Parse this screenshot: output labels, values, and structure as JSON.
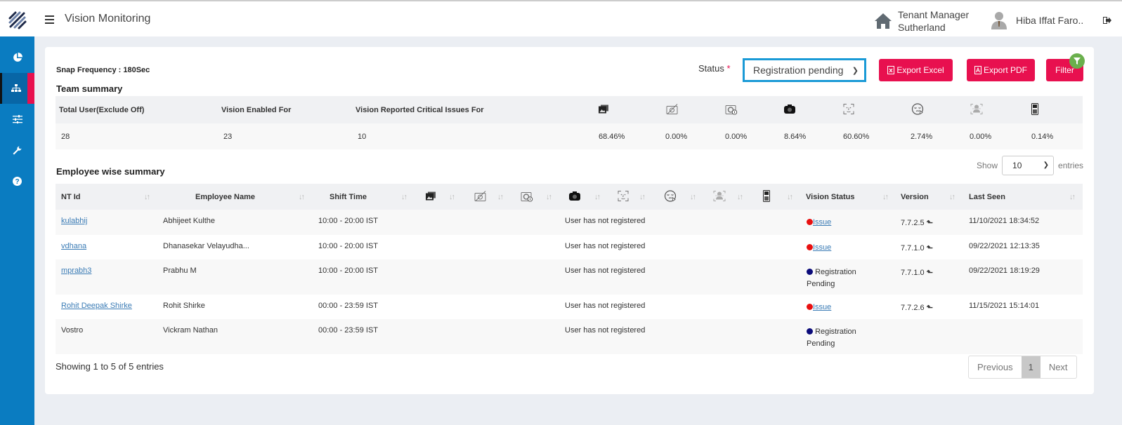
{
  "header": {
    "title": "Vision Monitoring",
    "tenant_role": "Tenant Manager",
    "tenant_name": "Sutherland",
    "user_name": "Hiba Iffat Faro.."
  },
  "sidebar": {
    "items": [
      {
        "name": "dashboard",
        "icon": "pie-chart-icon"
      },
      {
        "name": "hierarchy",
        "icon": "sitemap-icon",
        "active": true
      },
      {
        "name": "settings",
        "icon": "sliders-icon"
      },
      {
        "name": "tools",
        "icon": "wrench-icon"
      },
      {
        "name": "help",
        "icon": "question-icon"
      }
    ]
  },
  "toolbar": {
    "snap_frequency": "Snap Frequency : 180Sec",
    "status_label": "Status",
    "status_required": "*",
    "status_value": "Registration pending",
    "export_excel": "Export Excel",
    "export_pdf": "Export PDF",
    "filter": "Filter"
  },
  "team_summary": {
    "title": "Team summary",
    "headers": [
      "Total User(Exclude Off)",
      "Vision Enabled For",
      "Vision Reported Critical Issues For"
    ],
    "icon_headers": [
      "multiple-images-icon",
      "camera-off-icon",
      "camera-info-icon",
      "camera-icon",
      "face-scan-icon",
      "sleepy-face-icon",
      "person-scan-icon",
      "mobile-phone-icon"
    ],
    "values": [
      "28",
      "23",
      "10"
    ],
    "icon_values": [
      "68.46%",
      "0.00%",
      "0.00%",
      "8.64%",
      "60.60%",
      "2.74%",
      "0.00%",
      "0.14%"
    ]
  },
  "employee_summary": {
    "title": "Employee wise summary",
    "show_label": "Show",
    "entries_value": "10",
    "entries_label": "entries",
    "columns": [
      "NT Id",
      "Employee Name",
      "Shift Time",
      "Vision Status",
      "Version",
      "Last Seen"
    ],
    "rows": [
      {
        "nt_id": "kulabhij",
        "nt_link": true,
        "name": "Abhijeet Kulthe",
        "shift": "10:00 - 20:00 IST",
        "note": "User has not registered",
        "status": "Issue",
        "status_color": "#e81010",
        "status_link": true,
        "version": "7.7.2.5",
        "last_seen": "11/10/2021 18:34:52"
      },
      {
        "nt_id": "vdhana",
        "nt_link": true,
        "name": "Dhanasekar Velayudha...",
        "shift": "10:00 - 20:00 IST",
        "note": "User has not registered",
        "status": "Issue",
        "status_color": "#e81010",
        "status_link": true,
        "version": "7.7.1.0",
        "last_seen": "09/22/2021 12:13:35"
      },
      {
        "nt_id": "mprabh3",
        "nt_link": true,
        "name": "Prabhu M",
        "shift": "10:00 - 20:00 IST",
        "note": "User has not registered",
        "status": "Registration Pending",
        "status_color": "#0b0b7a",
        "status_link": false,
        "version": "7.7.1.0",
        "last_seen": "09/22/2021 18:19:29"
      },
      {
        "nt_id": "Rohit Deepak Shirke",
        "nt_link": true,
        "name": "Rohit Shirke",
        "shift": "00:00 - 23:59 IST",
        "note": "User has not registered",
        "status": "Issue",
        "status_color": "#e81010",
        "status_link": true,
        "version": "7.7.2.6",
        "last_seen": "11/15/2021 15:14:01"
      },
      {
        "nt_id": "Vostro",
        "nt_link": false,
        "name": "Vickram Nathan",
        "shift": "00:00 - 23:59 IST",
        "note": "User has not registered",
        "status": "Registration Pending",
        "status_color": "#0b0b7a",
        "status_link": false,
        "version": "",
        "last_seen": ""
      }
    ],
    "showing": "Showing 1 to 5 of 5 entries",
    "pagination": {
      "previous": "Previous",
      "current": "1",
      "next": "Next"
    }
  },
  "colors": {
    "primary": "#0a7cc1",
    "accent": "#e8104f",
    "filter_badge": "#6ab04c",
    "select_border": "#1a9ad6"
  }
}
